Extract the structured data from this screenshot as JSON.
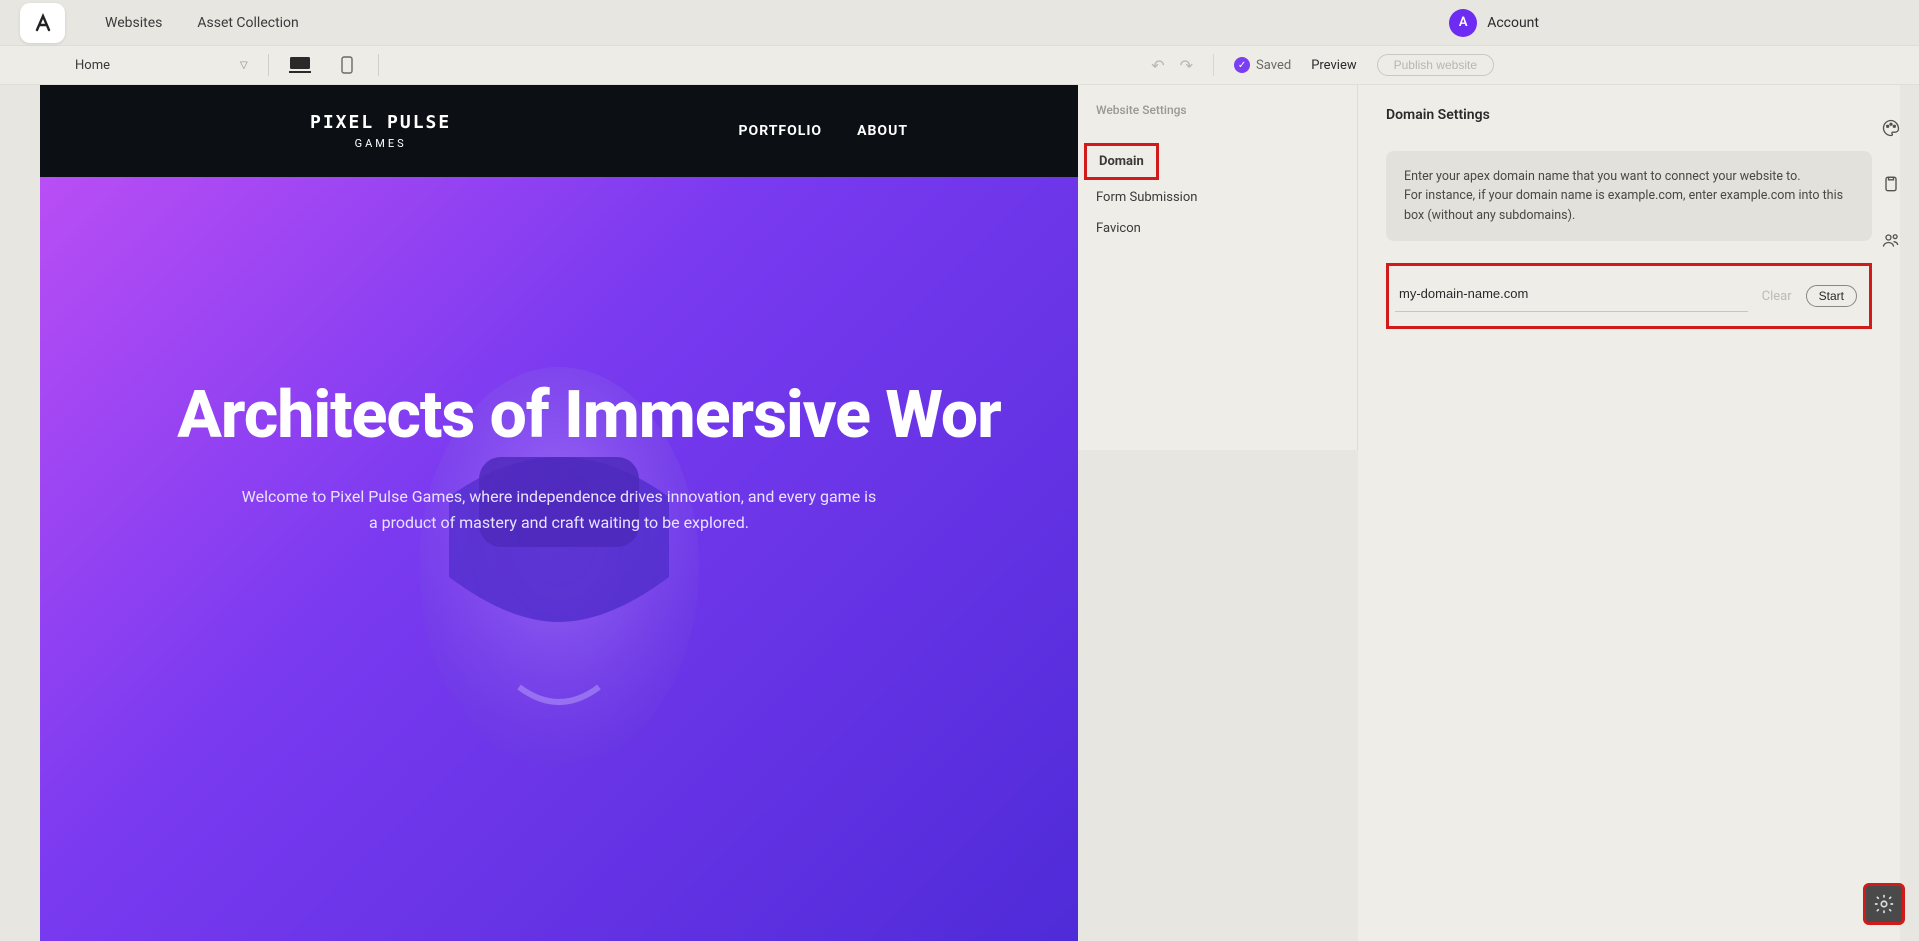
{
  "topbar": {
    "nav": {
      "websites": "Websites",
      "assets": "Asset Collection"
    },
    "account": {
      "initial": "A",
      "label": "Account"
    }
  },
  "toolbar": {
    "page": "Home",
    "saved": "Saved",
    "preview": "Preview",
    "publish": "Publish website"
  },
  "preview": {
    "logo_line1": "PIXEL PULSE",
    "logo_line2": "GAMES",
    "nav": {
      "portfolio": "PORTFOLIO",
      "about": "ABOUT"
    },
    "hero_title": "Architects of Immersive Wor",
    "hero_sub": "Welcome to Pixel Pulse Games, where independence drives innovation, and every game is a product of mastery and craft waiting to be explored."
  },
  "settings_menu": {
    "title": "Website Settings",
    "items": {
      "domain": "Domain",
      "form": "Form Submission",
      "favicon": "Favicon"
    }
  },
  "domain_panel": {
    "title": "Domain Settings",
    "info_line1": "Enter your apex domain name that you want to connect your website to.",
    "info_line2": "For instance, if your domain name is example.com, enter example.com into this box (without any subdomains).",
    "input_value": "my-domain-name.com",
    "clear": "Clear",
    "start": "Start"
  }
}
